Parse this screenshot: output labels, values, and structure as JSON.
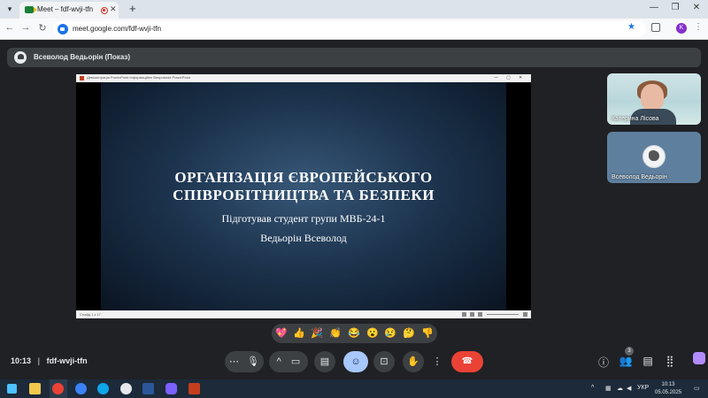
{
  "browser": {
    "tab_title": "Meet – fdf-wvji-tfn",
    "url": "meet.google.com/fdf-wvji-tfn",
    "profile_initial": "K"
  },
  "meet": {
    "presenter_label": "Всеволод Ведьорін (Показ)",
    "time": "10:13",
    "meeting_code": "fdf-wvji-tfn",
    "participant_badge": "3",
    "participants": [
      {
        "name": "Катерина Лісова"
      },
      {
        "name": "Всеволод Ведьорін"
      }
    ],
    "reactions": [
      "💖",
      "👍",
      "🎉",
      "👏",
      "😂",
      "😮",
      "😢",
      "🤔",
      "👎"
    ]
  },
  "slide": {
    "title_line1": "ОРГАНІЗАЦІЯ ЄВРОПЕЙСЬКОГО",
    "title_line2": "СПІВРОБІТНИЦТВА ТА БЕЗПЕКИ",
    "subtitle_line1": "Підготував студент групи МВБ-24-1",
    "subtitle_line2": "Ведьорін Всеволод",
    "app_bar_text": "Демонстрація PowerPoint   Інформаційне Bespokede   PowerPoint",
    "status_text": "Слайд 1 з 17"
  },
  "taskbar": {
    "language": "УКР",
    "time": "10:13",
    "date": "05.05.2025"
  },
  "colors": {
    "meet_bg": "#202124",
    "end_call": "#ea4335",
    "active_control": "#a8c7fa",
    "slide_bg": "#1e3753"
  }
}
